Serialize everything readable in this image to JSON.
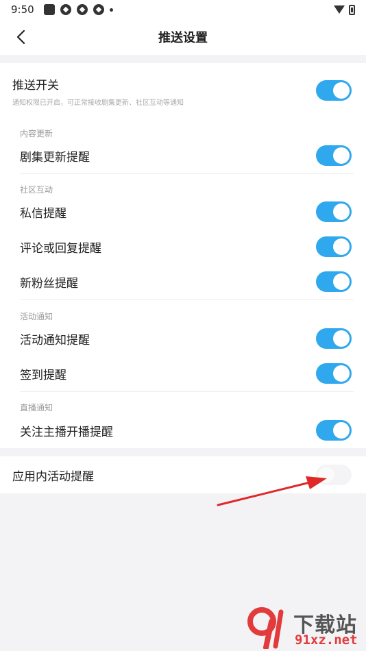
{
  "status_bar": {
    "time": "9:50"
  },
  "header": {
    "title": "推送设置"
  },
  "master": {
    "label": "推送开关",
    "desc": "通知权限已开启，可正常接收剧集更新、社区互动等通知",
    "on": true
  },
  "sections": [
    {
      "label": "内容更新",
      "items": [
        {
          "label": "剧集更新提醒",
          "on": true
        }
      ]
    },
    {
      "label": "社区互动",
      "items": [
        {
          "label": "私信提醒",
          "on": true
        },
        {
          "label": "评论或回复提醒",
          "on": true
        },
        {
          "label": "新粉丝提醒",
          "on": true
        }
      ]
    },
    {
      "label": "活动通知",
      "items": [
        {
          "label": "活动通知提醒",
          "on": true
        },
        {
          "label": "签到提醒",
          "on": true
        }
      ]
    },
    {
      "label": "直播通知",
      "items": [
        {
          "label": "关注主播开播提醒",
          "on": true
        }
      ]
    }
  ],
  "app_activity": {
    "label": "应用内活动提醒",
    "on": false
  },
  "colors": {
    "accent": "#2fa8ee",
    "background": "#f3f3f5",
    "arrow": "#e02828"
  },
  "watermark": {
    "text": "下载站",
    "url": "91xz.net"
  }
}
